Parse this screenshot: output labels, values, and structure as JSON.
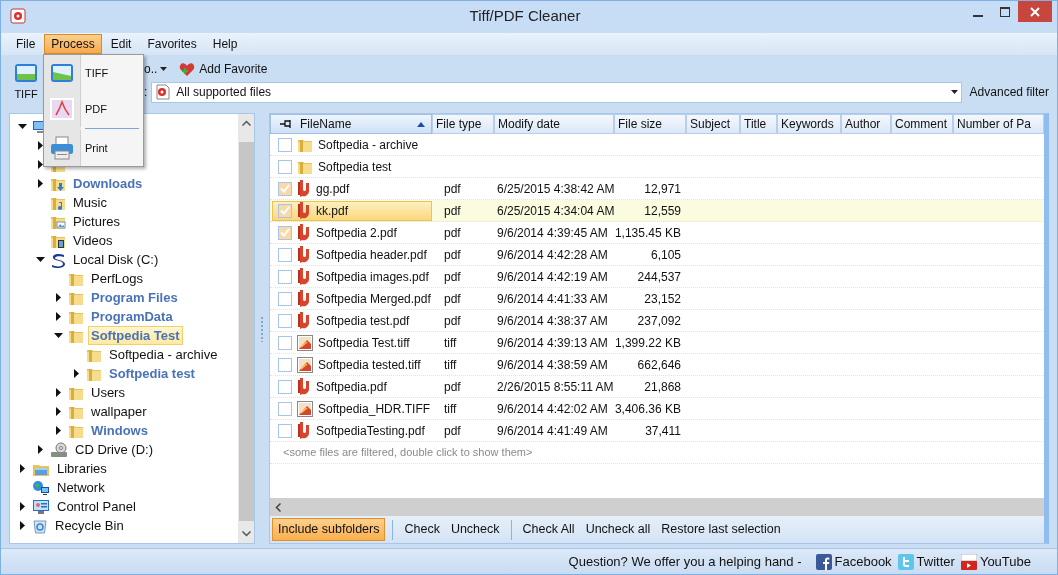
{
  "window": {
    "title": "Tiff/PDF Cleaner"
  },
  "menu": [
    {
      "label": "File",
      "selected": false
    },
    {
      "label": "Process",
      "selected": true
    },
    {
      "label": "Edit",
      "selected": false
    },
    {
      "label": "Favorites",
      "selected": false
    },
    {
      "label": "Help",
      "selected": false
    }
  ],
  "process_menu": [
    {
      "kind": "tiff",
      "label": "TIFF"
    },
    {
      "kind": "pdf",
      "label": "PDF"
    },
    {
      "kind": "separator"
    },
    {
      "kind": "print",
      "label": "Print"
    }
  ],
  "toolbar": {
    "tiff_button": "TIFF",
    "go_button": "o..",
    "add_favorite": "Add Favorite"
  },
  "filter": {
    "label": ":",
    "value": "All supported files",
    "advanced": "Advanced filter"
  },
  "tree": [
    {
      "kind": "computer",
      "expanded": true,
      "children": [
        {
          "expanded": false
        },
        {
          "kind": "folder",
          "expanded": false
        },
        {
          "label": "Downloads",
          "kind": "download",
          "expanded": false,
          "bold": true,
          "selected": false
        },
        {
          "label": "Music",
          "kind": "music",
          "bold": false,
          "selected": false
        },
        {
          "label": "Pictures",
          "kind": "pictures",
          "bold": false,
          "selected": false
        },
        {
          "label": "Videos",
          "kind": "videos",
          "bold": false,
          "selected": false
        },
        {
          "label": "Local Disk (C:)",
          "kind": "disk",
          "expanded": true,
          "bold": false,
          "selected": false,
          "children": [
            {
              "label": "PerfLogs",
              "kind": "folder",
              "bold": false,
              "selected": false
            },
            {
              "label": "Program Files",
              "kind": "folder",
              "expanded": false,
              "bold": true,
              "selected": false
            },
            {
              "label": "ProgramData",
              "kind": "folder",
              "expanded": false,
              "bold": true,
              "selected": false
            },
            {
              "label": "Softpedia Test",
              "kind": "folder",
              "expanded": true,
              "bold": true,
              "selected": true,
              "children": [
                {
                  "label": "Softpedia - archive",
                  "kind": "folder",
                  "bold": false,
                  "selected": false
                },
                {
                  "label": "Softpedia test",
                  "kind": "folder",
                  "expanded": false,
                  "bold": true,
                  "selected": false
                }
              ]
            },
            {
              "label": "Users",
              "kind": "folder",
              "expanded": false,
              "bold": false,
              "selected": false
            },
            {
              "label": "wallpaper",
              "kind": "folder",
              "expanded": false,
              "bold": false,
              "selected": false
            },
            {
              "label": "Windows",
              "kind": "folder",
              "expanded": false,
              "bold": true,
              "selected": false
            }
          ]
        },
        {
          "label": "CD Drive (D:)",
          "kind": "cd",
          "expanded": false,
          "bold": false,
          "selected": false
        }
      ]
    },
    {
      "label": "Libraries",
      "kind": "library",
      "expanded": false,
      "bold": false,
      "selected": false
    },
    {
      "label": "Network",
      "kind": "network",
      "bold": false,
      "selected": false
    },
    {
      "label": "Control Panel",
      "kind": "control",
      "expanded": false,
      "bold": false,
      "selected": false
    },
    {
      "label": "Recycle Bin",
      "kind": "recycle",
      "expanded": false,
      "bold": false,
      "selected": false
    }
  ],
  "files": {
    "columns": [
      {
        "label": "FileName",
        "sorted": true
      },
      {
        "label": "File type",
        "sorted": false
      },
      {
        "label": "Modify date",
        "sorted": false
      },
      {
        "label": "File size",
        "sorted": false
      },
      {
        "label": "Subject",
        "sorted": false
      },
      {
        "label": "Title",
        "sorted": false
      },
      {
        "label": "Keywords",
        "sorted": false
      },
      {
        "label": "Author",
        "sorted": false
      },
      {
        "label": "Comment",
        "sorted": false
      },
      {
        "label": "Number of Pa",
        "sorted": false
      }
    ],
    "rows": [
      {
        "kind": "folder",
        "name": "Softpedia - archive",
        "checked": false,
        "selected": false
      },
      {
        "kind": "folder",
        "name": "Softpedia test",
        "checked": false,
        "selected": false
      },
      {
        "kind": "pdf",
        "name": "gg.pdf",
        "type": "pdf",
        "date": "6/25/2015 4:38:42 AM",
        "size": "12,971",
        "checked": true,
        "selected": false
      },
      {
        "kind": "pdf",
        "name": "kk.pdf",
        "type": "pdf",
        "date": "6/25/2015 4:34:04 AM",
        "size": "12,559",
        "checked": true,
        "selected": true
      },
      {
        "kind": "pdf",
        "name": "Softpedia 2.pdf",
        "type": "pdf",
        "date": "9/6/2014 4:39:45 AM",
        "size": "1,135.45 KB",
        "checked": true,
        "selected": false
      },
      {
        "kind": "pdf",
        "name": "Softpedia header.pdf",
        "type": "pdf",
        "date": "9/6/2014 4:42:28 AM",
        "size": "6,105",
        "checked": false,
        "selected": false
      },
      {
        "kind": "pdf",
        "name": "Softpedia images.pdf",
        "type": "pdf",
        "date": "9/6/2014 4:42:19 AM",
        "size": "244,537",
        "checked": false,
        "selected": false
      },
      {
        "kind": "pdf",
        "name": "Softpedia Merged.pdf",
        "type": "pdf",
        "date": "9/6/2014 4:41:33 AM",
        "size": "23,152",
        "checked": false,
        "selected": false
      },
      {
        "kind": "pdf",
        "name": "Softpedia test.pdf",
        "type": "pdf",
        "date": "9/6/2014 4:38:37 AM",
        "size": "237,092",
        "checked": false,
        "selected": false
      },
      {
        "kind": "tiff",
        "name": "Softpedia Test.tiff",
        "type": "tiff",
        "date": "9/6/2014 4:39:13 AM",
        "size": "1,399.22 KB",
        "checked": false,
        "selected": false
      },
      {
        "kind": "tiff",
        "name": "Softpedia tested.tiff",
        "type": "tiff",
        "date": "9/6/2014 4:38:59 AM",
        "size": "662,646",
        "checked": false,
        "selected": false
      },
      {
        "kind": "pdf",
        "name": "Softpedia.pdf",
        "type": "pdf",
        "date": "2/26/2015 8:55:11 AM",
        "size": "21,868",
        "checked": false,
        "selected": false
      },
      {
        "kind": "tiff",
        "name": "Softpedia_HDR.TIFF",
        "type": "tiff",
        "date": "9/6/2014 4:42:02 AM",
        "size": "3,406.36 KB",
        "checked": false,
        "selected": false
      },
      {
        "kind": "pdf",
        "name": "SoftpediaTesting.pdf",
        "type": "pdf",
        "date": "9/6/2014 4:41:49 AM",
        "size": "37,411",
        "checked": false,
        "selected": false
      }
    ],
    "note": "<some files are filtered, double click to show them>"
  },
  "actions": [
    {
      "kind": "toggle",
      "label": "Include subfolders",
      "on": true
    },
    {
      "kind": "separator"
    },
    {
      "kind": "button",
      "label": "Check"
    },
    {
      "kind": "button",
      "label": "Uncheck"
    },
    {
      "kind": "separator"
    },
    {
      "kind": "button",
      "label": "Check All"
    },
    {
      "kind": "button",
      "label": "Uncheck all"
    },
    {
      "kind": "button",
      "label": "Restore last selection"
    }
  ],
  "status": {
    "text": "Question? We offer you a helping hand -",
    "links": [
      {
        "kind": "facebook",
        "label": "Facebook"
      },
      {
        "kind": "twitter",
        "label": "Twitter"
      },
      {
        "kind": "youtube",
        "label": "YouTube"
      }
    ]
  }
}
